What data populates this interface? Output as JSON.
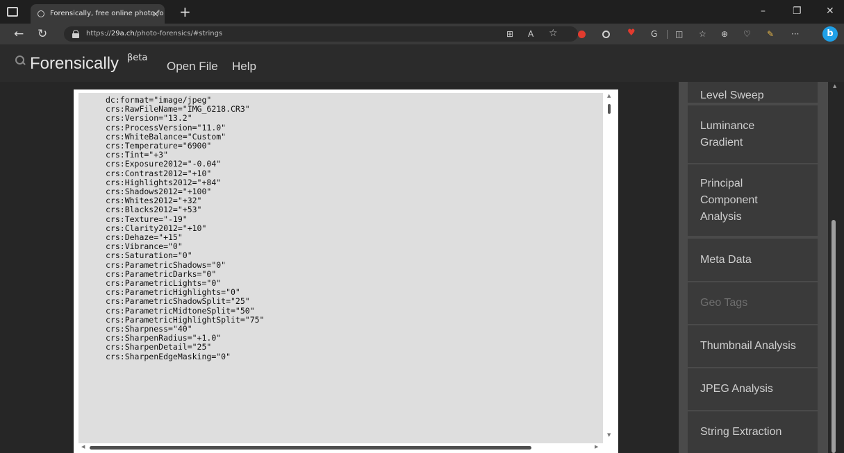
{
  "browser": {
    "tab_title": "Forensically, free online photo fo",
    "tab_close": "×",
    "new_tab": "+",
    "url_prefix": "https://",
    "url_domain": "29a.ch",
    "url_path": "/photo-forensics/#strings",
    "window_controls": {
      "minimize": "–",
      "restore": "❐",
      "close": "✕"
    },
    "toolbar_icons": [
      "app-available-icon",
      "read-aloud-icon",
      "favorite-star-icon",
      "extension-red-icon",
      "extension-circle-icon",
      "extension-heart-icon",
      "extension-g-icon",
      "split-screen-icon",
      "favorites-icon",
      "collections-icon",
      "browser-essentials-icon",
      "extension-brush-icon",
      "more-icon",
      "bing-icon"
    ]
  },
  "site": {
    "title": "Forensically",
    "title_sup": "βeta",
    "nav": {
      "open_file": "Open File",
      "help": "Help"
    }
  },
  "strings_text": "dc:format=\"image/jpeg\"\ncrs:RawFileName=\"IMG_6218.CR3\"\ncrs:Version=\"13.2\"\ncrs:ProcessVersion=\"11.0\"\ncrs:WhiteBalance=\"Custom\"\ncrs:Temperature=\"6900\"\ncrs:Tint=\"+3\"\ncrs:Exposure2012=\"-0.04\"\ncrs:Contrast2012=\"+10\"\ncrs:Highlights2012=\"+84\"\ncrs:Shadows2012=\"+100\"\ncrs:Whites2012=\"+32\"\ncrs:Blacks2012=\"+53\"\ncrs:Texture=\"-19\"\ncrs:Clarity2012=\"+10\"\ncrs:Dehaze=\"+15\"\ncrs:Vibrance=\"0\"\ncrs:Saturation=\"0\"\ncrs:ParametricShadows=\"0\"\ncrs:ParametricDarks=\"0\"\ncrs:ParametricLights=\"0\"\ncrs:ParametricHighlights=\"0\"\ncrs:ParametricShadowSplit=\"25\"\ncrs:ParametricMidtoneSplit=\"50\"\ncrs:ParametricHighlightSplit=\"75\"\ncrs:Sharpness=\"40\"\ncrs:SharpenRadius=\"+1.0\"\ncrs:SharpenDetail=\"25\"\ncrs:SharpenEdgeMasking=\"0\"",
  "tools": {
    "level_sweep": "Level Sweep",
    "luminance_gradient": "Luminance\nGradient",
    "pca": "Principal\nComponent\nAnalysis",
    "meta_data": "Meta Data",
    "geo_tags": "Geo Tags",
    "thumbnail_analysis": "Thumbnail Analysis",
    "jpeg_analysis": "JPEG Analysis",
    "string_extraction": "String Extraction"
  },
  "colors": {
    "page_bg": "#262626",
    "panel_bg": "#4a4a4a",
    "tool_bg": "#3a3a3a",
    "text_area_bg": "#dedede",
    "accent_bing": "#1fa0e8"
  }
}
